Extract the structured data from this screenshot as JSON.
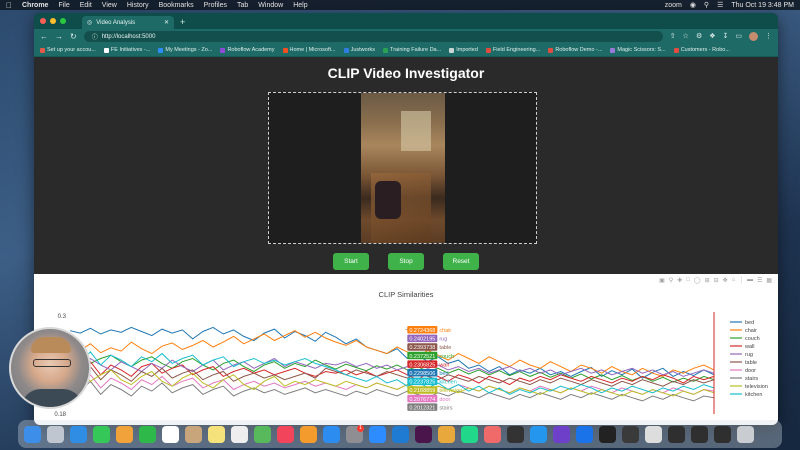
{
  "menubar": {
    "app": "Chrome",
    "items": [
      "File",
      "Edit",
      "View",
      "History",
      "Bookmarks",
      "Profiles",
      "Tab",
      "Window",
      "Help"
    ],
    "zoom": "zoom",
    "clock": "Thu Oct 19  3:48 PM"
  },
  "browser": {
    "tab_title": "Video Analysis",
    "url": "http://localhost:5000",
    "bookmarks": [
      {
        "label": "Set up your accou...",
        "color": "#e15a4a"
      },
      {
        "label": "FE Initiatives -...",
        "color": "#ffffff"
      },
      {
        "label": "My Meetings - Zo...",
        "color": "#2d8cff"
      },
      {
        "label": "Roboflow Academy",
        "color": "#8d4bd8"
      },
      {
        "label": "Home | Microsoft...",
        "color": "#f25022"
      },
      {
        "label": "Justworks",
        "color": "#2f7de1"
      },
      {
        "label": "Training Failure Da...",
        "color": "#2aa052"
      },
      {
        "label": "Imported",
        "color": "#c9d5d4"
      },
      {
        "label": "Field Engineering...",
        "color": "#e04c3f"
      },
      {
        "label": "Roboflow Demo -...",
        "color": "#e04c3f"
      },
      {
        "label": "Magic Scissors: S...",
        "color": "#9a7ad8"
      },
      {
        "label": "Customers - Robo...",
        "color": "#e04c3f"
      }
    ]
  },
  "page": {
    "title": "CLIP Video Investigator",
    "buttons": {
      "start": "Start",
      "stop": "Stop",
      "reset": "Reset"
    }
  },
  "chart_data": {
    "type": "line",
    "title": "CLIP Similarities",
    "y_tick_labels": [
      "0.3",
      "0.18"
    ],
    "ylim": [
      0.18,
      0.3
    ],
    "legend_position": "right",
    "series": [
      {
        "name": "bed",
        "color": "#1f77b4",
        "values": [
          0.282,
          0.279,
          0.285,
          0.278,
          0.283,
          0.28,
          0.286,
          0.281,
          0.276,
          0.284,
          0.279,
          0.283,
          0.272,
          0.281,
          0.286,
          0.278,
          0.283,
          0.275,
          0.27,
          0.279,
          0.284,
          0.273,
          0.281,
          0.276,
          0.269,
          0.28,
          0.274,
          0.266,
          0.272,
          0.262,
          0.258,
          0.254,
          0.26,
          0.248,
          0.252,
          0.244,
          0.25,
          0.242,
          0.246,
          0.236,
          0.24,
          0.232,
          0.238,
          0.228,
          0.234,
          0.23,
          0.236,
          0.228,
          0.232,
          0.226,
          0.232,
          0.237,
          0.226,
          0.233,
          0.228,
          0.235,
          0.224,
          0.231,
          0.236,
          0.226,
          0.232,
          0.227,
          0.234,
          0.228
        ]
      },
      {
        "name": "chair",
        "color": "#ff7f0e",
        "values": [
          0.262,
          0.258,
          0.266,
          0.255,
          0.261,
          0.257,
          0.268,
          0.26,
          0.254,
          0.263,
          0.267,
          0.259,
          0.264,
          0.27,
          0.262,
          0.268,
          0.275,
          0.266,
          0.272,
          0.278,
          0.27,
          0.276,
          0.282,
          0.274,
          0.28,
          0.273,
          0.268,
          0.264,
          0.27,
          0.262,
          0.258,
          0.254,
          0.262,
          0.256,
          0.25,
          0.258,
          0.252,
          0.246,
          0.254,
          0.248,
          0.242,
          0.25,
          0.244,
          0.238,
          0.246,
          0.24,
          0.236,
          0.244,
          0.238,
          0.232,
          0.24,
          0.236,
          0.23,
          0.238,
          0.232,
          0.228,
          0.236,
          0.23,
          0.226,
          0.234,
          0.23,
          0.236,
          0.24,
          0.234
        ]
      },
      {
        "name": "couch",
        "color": "#2ca02c",
        "values": [
          0.245,
          0.25,
          0.242,
          0.248,
          0.252,
          0.244,
          0.238,
          0.246,
          0.25,
          0.242,
          0.236,
          0.244,
          0.248,
          0.24,
          0.234,
          0.242,
          0.246,
          0.238,
          0.232,
          0.24,
          0.244,
          0.236,
          0.242,
          0.238,
          0.246,
          0.24,
          0.235,
          0.241,
          0.237,
          0.233,
          0.239,
          0.235,
          0.24,
          0.234,
          0.238,
          0.232,
          0.236,
          0.23,
          0.235,
          0.229,
          0.234,
          0.228,
          0.233,
          0.227,
          0.232,
          0.226,
          0.231,
          0.225,
          0.23,
          0.224,
          0.229,
          0.223,
          0.228,
          0.222,
          0.227,
          0.221,
          0.226,
          0.22,
          0.225,
          0.219,
          0.224,
          0.22,
          0.226,
          0.222
        ]
      },
      {
        "name": "wall",
        "color": "#d62728",
        "values": [
          0.238,
          0.232,
          0.244,
          0.228,
          0.24,
          0.234,
          0.226,
          0.238,
          0.242,
          0.23,
          0.236,
          0.24,
          0.228,
          0.234,
          0.238,
          0.226,
          0.232,
          0.236,
          0.23,
          0.234,
          0.228,
          0.232,
          0.236,
          0.23,
          0.226,
          0.232,
          0.23,
          0.234,
          0.228,
          0.232,
          0.226,
          0.23,
          0.234,
          0.228,
          0.222,
          0.23,
          0.226,
          0.22,
          0.228,
          0.224,
          0.218,
          0.226,
          0.222,
          0.216,
          0.224,
          0.22,
          0.226,
          0.222,
          0.228,
          0.224,
          0.22,
          0.226,
          0.222,
          0.218,
          0.224,
          0.22,
          0.226,
          0.222,
          0.228,
          0.224,
          0.218,
          0.226,
          0.222,
          0.226
        ]
      },
      {
        "name": "rug",
        "color": "#9467bd",
        "values": [
          0.242,
          0.236,
          0.248,
          0.24,
          0.234,
          0.244,
          0.238,
          0.232,
          0.242,
          0.236,
          0.246,
          0.238,
          0.232,
          0.24,
          0.246,
          0.234,
          0.24,
          0.244,
          0.236,
          0.242,
          0.248,
          0.238,
          0.244,
          0.24,
          0.236,
          0.242,
          0.24,
          0.244,
          0.238,
          0.242,
          0.236,
          0.24,
          0.234,
          0.238,
          0.242,
          0.236,
          0.24,
          0.234,
          0.238,
          0.232,
          0.236,
          0.23,
          0.234,
          0.238,
          0.232,
          0.236,
          0.23,
          0.234,
          0.228,
          0.232,
          0.236,
          0.23,
          0.234,
          0.228,
          0.232,
          0.236,
          0.23,
          0.234,
          0.228,
          0.232,
          0.226,
          0.23,
          0.234,
          0.23
        ]
      },
      {
        "name": "table",
        "color": "#8c564b",
        "values": [
          0.232,
          0.226,
          0.238,
          0.222,
          0.234,
          0.228,
          0.22,
          0.232,
          0.226,
          0.236,
          0.224,
          0.23,
          0.234,
          0.222,
          0.228,
          0.232,
          0.22,
          0.226,
          0.23,
          0.224,
          0.228,
          0.222,
          0.226,
          0.23,
          0.224,
          0.236,
          0.232,
          0.228,
          0.234,
          0.23,
          0.226,
          0.232,
          0.228,
          0.224,
          0.23,
          0.226,
          0.222,
          0.228,
          0.224,
          0.22,
          0.226,
          0.222,
          0.218,
          0.224,
          0.22,
          0.216,
          0.222,
          0.218,
          0.224,
          0.22,
          0.216,
          0.222,
          0.218,
          0.214,
          0.22,
          0.216,
          0.222,
          0.218,
          0.214,
          0.22,
          0.216,
          0.222,
          0.218,
          0.222
        ]
      },
      {
        "name": "door",
        "color": "#e377c2",
        "values": [
          0.222,
          0.216,
          0.228,
          0.212,
          0.224,
          0.218,
          0.21,
          0.222,
          0.216,
          0.226,
          0.214,
          0.22,
          0.224,
          0.212,
          0.218,
          0.222,
          0.21,
          0.216,
          0.22,
          0.214,
          0.218,
          0.212,
          0.216,
          0.22,
          0.214,
          0.218,
          0.214,
          0.21,
          0.216,
          0.212,
          0.218,
          0.214,
          0.21,
          0.216,
          0.212,
          0.208,
          0.214,
          0.21,
          0.216,
          0.212,
          0.208,
          0.214,
          0.21,
          0.206,
          0.212,
          0.208,
          0.214,
          0.21,
          0.206,
          0.212,
          0.208,
          0.214,
          0.21,
          0.206,
          0.212,
          0.208,
          0.204,
          0.21,
          0.206,
          0.212,
          0.208,
          0.204,
          0.21,
          0.208
        ]
      },
      {
        "name": "stairs",
        "color": "#7f7f7f",
        "values": [
          0.214,
          0.208,
          0.22,
          0.204,
          0.216,
          0.21,
          0.202,
          0.214,
          0.208,
          0.218,
          0.206,
          0.212,
          0.216,
          0.204,
          0.21,
          0.214,
          0.202,
          0.208,
          0.212,
          0.206,
          0.21,
          0.204,
          0.208,
          0.212,
          0.206,
          0.21,
          0.206,
          0.202,
          0.208,
          0.204,
          0.21,
          0.206,
          0.202,
          0.208,
          0.204,
          0.2,
          0.206,
          0.202,
          0.208,
          0.204,
          0.2,
          0.206,
          0.202,
          0.198,
          0.204,
          0.2,
          0.206,
          0.202,
          0.198,
          0.204,
          0.2,
          0.206,
          0.202,
          0.198,
          0.204,
          0.2,
          0.196,
          0.202,
          0.198,
          0.204,
          0.2,
          0.196,
          0.202,
          0.2
        ]
      },
      {
        "name": "television",
        "color": "#bcbd22",
        "values": [
          0.226,
          0.232,
          0.22,
          0.228,
          0.234,
          0.222,
          0.216,
          0.226,
          0.232,
          0.22,
          0.214,
          0.224,
          0.23,
          0.218,
          0.212,
          0.222,
          0.228,
          0.216,
          0.21,
          0.22,
          0.226,
          0.214,
          0.22,
          0.216,
          0.222,
          0.218,
          0.214,
          0.22,
          0.216,
          0.212,
          0.218,
          0.214,
          0.21,
          0.216,
          0.212,
          0.208,
          0.214,
          0.21,
          0.206,
          0.212,
          0.208,
          0.214,
          0.21,
          0.206,
          0.212,
          0.208,
          0.204,
          0.21,
          0.206,
          0.212,
          0.208,
          0.204,
          0.21,
          0.206,
          0.202,
          0.208,
          0.204,
          0.21,
          0.206,
          0.202,
          0.208,
          0.204,
          0.21,
          0.206
        ]
      },
      {
        "name": "kitchen",
        "color": "#17becf",
        "values": [
          0.25,
          0.244,
          0.256,
          0.24,
          0.252,
          0.246,
          0.238,
          0.25,
          0.244,
          0.254,
          0.242,
          0.248,
          0.252,
          0.24,
          0.246,
          0.25,
          0.238,
          0.244,
          0.248,
          0.242,
          0.246,
          0.24,
          0.244,
          0.248,
          0.242,
          0.238,
          0.234,
          0.228,
          0.224,
          0.22,
          0.226,
          0.218,
          0.222,
          0.214,
          0.22,
          0.212,
          0.218,
          0.21,
          0.216,
          0.208,
          0.214,
          0.206,
          0.212,
          0.204,
          0.21,
          0.206,
          0.212,
          0.208,
          0.214,
          0.21,
          0.216,
          0.212,
          0.206,
          0.212,
          0.208,
          0.214,
          0.21,
          0.206,
          0.212,
          0.208,
          0.214,
          0.21,
          0.216,
          0.212
        ]
      }
    ],
    "hover_index": 33,
    "hover_labels": [
      {
        "text": "0.2724368",
        "name": "chair",
        "color": "#ff7f0e"
      },
      {
        "text": "0.2402195",
        "name": "rug",
        "color": "#9467bd"
      },
      {
        "text": "0.2393738",
        "name": "table",
        "color": "#8c564b"
      },
      {
        "text": "0.2372521",
        "name": "couch",
        "color": "#2ca02c"
      },
      {
        "text": "0.2306825",
        "name": "wall",
        "color": "#d62728"
      },
      {
        "text": "0.2298506",
        "name": "bed",
        "color": "#1f77b4"
      },
      {
        "text": "0.2237825",
        "name": "kitchen",
        "color": "#17becf"
      },
      {
        "text": "0.2168859",
        "name": "television",
        "color": "#bcbd22"
      },
      {
        "text": "0.2076774",
        "name": "door",
        "color": "#e377c2"
      },
      {
        "text": "0.2012321",
        "name": "stairs",
        "color": "#7f7f7f"
      }
    ]
  },
  "dock_apps": [
    {
      "name": "finder",
      "color": "#3d8ee8"
    },
    {
      "name": "launchpad",
      "color": "#c0c6d0"
    },
    {
      "name": "safari",
      "color": "#2f8de4"
    },
    {
      "name": "messages",
      "color": "#36c759"
    },
    {
      "name": "photos",
      "color": "#f2a23a"
    },
    {
      "name": "facetime",
      "color": "#2fb84a"
    },
    {
      "name": "calendar",
      "color": "#ffffff"
    },
    {
      "name": "contacts",
      "color": "#c8a57a"
    },
    {
      "name": "notes",
      "color": "#f6e27a"
    },
    {
      "name": "freeform",
      "color": "#eeeeee"
    },
    {
      "name": "maps",
      "color": "#58b85c"
    },
    {
      "name": "music",
      "color": "#f2445a"
    },
    {
      "name": "pages",
      "color": "#f39b2d"
    },
    {
      "name": "app-store",
      "color": "#2d8cf0"
    },
    {
      "name": "settings",
      "color": "#8e8e93"
    },
    {
      "name": "zoom",
      "color": "#2d8cff"
    },
    {
      "name": "vscode",
      "color": "#1f7ad1"
    },
    {
      "name": "slack",
      "color": "#4a154b"
    },
    {
      "name": "chrome",
      "color": "#e9a83b"
    },
    {
      "name": "pycharm",
      "color": "#21d789"
    },
    {
      "name": "asana",
      "color": "#f06a6a"
    },
    {
      "name": "cursor",
      "color": "#333333"
    },
    {
      "name": "docker",
      "color": "#2496ed"
    },
    {
      "name": "github",
      "color": "#6e40c9"
    },
    {
      "name": "1password",
      "color": "#1a73e8"
    },
    {
      "name": "terminal",
      "color": "#222222"
    },
    {
      "name": "activity-monitor",
      "color": "#3a3a3a"
    },
    {
      "name": "downloads",
      "color": "#dddddd"
    },
    {
      "name": "window-a",
      "color": "#2f2f2f"
    },
    {
      "name": "window-b",
      "color": "#2f2f2f"
    },
    {
      "name": "window-c",
      "color": "#2f2f2f"
    },
    {
      "name": "trash",
      "color": "#c9ccd1"
    }
  ],
  "dock_badge": "1"
}
